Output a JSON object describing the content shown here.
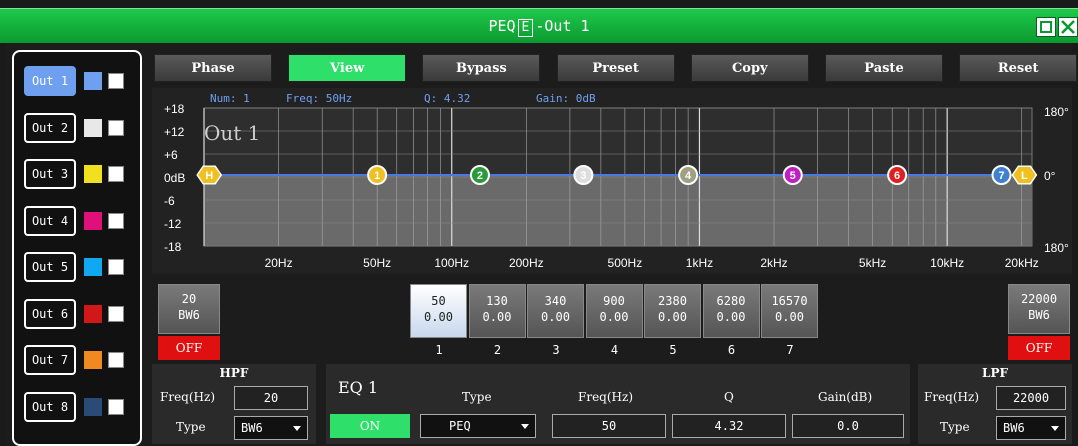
{
  "window": {
    "title_prefix": "PEQ",
    "title_box": "E",
    "title_suffix": "-Out 1"
  },
  "outputs": [
    {
      "label": "Out 1",
      "color": "#6fa0f0",
      "selected": true
    },
    {
      "label": "Out 2",
      "color": "#e8e8e8",
      "selected": false
    },
    {
      "label": "Out 3",
      "color": "#f0e020",
      "selected": false
    },
    {
      "label": "Out 4",
      "color": "#e0107a",
      "selected": false
    },
    {
      "label": "Out 5",
      "color": "#10a8f0",
      "selected": false
    },
    {
      "label": "Out 6",
      "color": "#d01818",
      "selected": false
    },
    {
      "label": "Out 7",
      "color": "#f08a20",
      "selected": false
    },
    {
      "label": "Out 8",
      "color": "#2a4a78",
      "selected": false
    }
  ],
  "toolbar": [
    "Phase",
    "View",
    "Bypass",
    "Preset",
    "Copy",
    "Paste",
    "Reset"
  ],
  "toolbar_active": "View",
  "graph": {
    "info": {
      "num": "Num:  1",
      "freq": "Freq:  50Hz",
      "q": "Q:  4.32",
      "gain": "Gain:  0dB"
    },
    "channel_label": "Out 1",
    "db_labels": [
      "+18",
      "+12",
      "+6",
      "0dB",
      "-6",
      "-12",
      "-18"
    ],
    "phase_labels": [
      "180°",
      "0°",
      "180°"
    ],
    "freq_labels": [
      "20Hz",
      "50Hz",
      "100Hz",
      "200Hz",
      "500Hz",
      "1kHz",
      "2kHz",
      "5kHz",
      "10kHz",
      "20kHz"
    ],
    "markers": [
      {
        "label": "H",
        "color": "#f0c020",
        "shape": "hex"
      },
      {
        "label": "1",
        "color": "#f0c020",
        "shape": "circle"
      },
      {
        "label": "2",
        "color": "#2a9a3a",
        "shape": "circle"
      },
      {
        "label": "3",
        "color": "#dddddd",
        "shape": "circle"
      },
      {
        "label": "4",
        "color": "#a0a080",
        "shape": "circle"
      },
      {
        "label": "5",
        "color": "#c020c0",
        "shape": "circle"
      },
      {
        "label": "6",
        "color": "#e02020",
        "shape": "circle"
      },
      {
        "label": "7",
        "color": "#4080d0",
        "shape": "circle"
      },
      {
        "label": "L",
        "color": "#f0c020",
        "shape": "hex"
      }
    ],
    "accent_line": "#4a7adf"
  },
  "hpf_box": {
    "freq": "20",
    "type": "BW6",
    "state": "OFF"
  },
  "lpf_box": {
    "freq": "22000",
    "type": "BW6",
    "state": "OFF"
  },
  "eq_bands": [
    {
      "freq": "50",
      "gain": "0.00",
      "index": "1",
      "selected": true
    },
    {
      "freq": "130",
      "gain": "0.00",
      "index": "2",
      "selected": false
    },
    {
      "freq": "340",
      "gain": "0.00",
      "index": "3",
      "selected": false
    },
    {
      "freq": "900",
      "gain": "0.00",
      "index": "4",
      "selected": false
    },
    {
      "freq": "2380",
      "gain": "0.00",
      "index": "5",
      "selected": false
    },
    {
      "freq": "6280",
      "gain": "0.00",
      "index": "6",
      "selected": false
    },
    {
      "freq": "16570",
      "gain": "0.00",
      "index": "7",
      "selected": false
    }
  ],
  "hpf": {
    "title": "HPF",
    "freq_label": "Freq(Hz)",
    "freq": "20",
    "type_label": "Type",
    "type": "BW6"
  },
  "eq": {
    "title": "EQ 1",
    "state": "ON",
    "type_label": "Type",
    "type": "PEQ",
    "freq_label": "Freq(Hz)",
    "freq": "50",
    "q_label": "Q",
    "q": "4.32",
    "gain_label": "Gain(dB)",
    "gain": "0.0"
  },
  "lpf": {
    "title": "LPF",
    "freq_label": "Freq(Hz)",
    "freq": "22000",
    "type_label": "Type",
    "type": "BW6"
  }
}
